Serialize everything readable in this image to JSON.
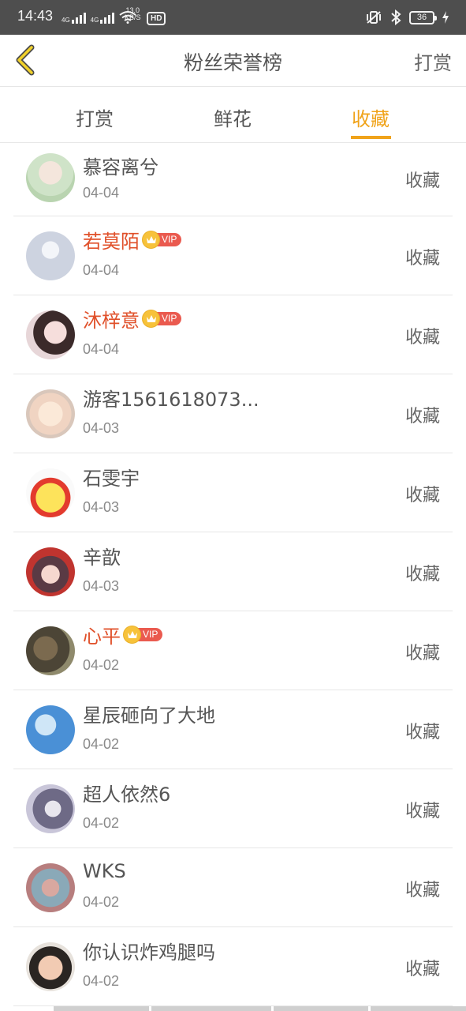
{
  "status_bar": {
    "time": "14:43",
    "net_type_1": "4G",
    "net_type_2": "4G",
    "speed_value": "13.0",
    "speed_unit": "KB/S",
    "hd_label": "HD",
    "battery": "36"
  },
  "header": {
    "title": "粉丝荣誉榜",
    "right_action": "打赏"
  },
  "tabs": [
    {
      "label": "打赏",
      "active": false
    },
    {
      "label": "鲜花",
      "active": false
    },
    {
      "label": "收藏",
      "active": true
    }
  ],
  "colors": {
    "accent": "#f0a31a",
    "vip_name": "#e0502a",
    "vip_badge": "#ea5a4f",
    "crown": "#f7c23a"
  },
  "fans": [
    {
      "name": "慕容离兮",
      "date": "04-04",
      "action": "收藏",
      "vip": false,
      "vip_label": ""
    },
    {
      "name": "若莫陌",
      "date": "04-04",
      "action": "收藏",
      "vip": true,
      "vip_label": "VIP"
    },
    {
      "name": "沐梓意",
      "date": "04-04",
      "action": "收藏",
      "vip": true,
      "vip_label": "VIP"
    },
    {
      "name": "游客1561618073...",
      "date": "04-03",
      "action": "收藏",
      "vip": false,
      "vip_label": ""
    },
    {
      "name": "石雯宇",
      "date": "04-03",
      "action": "收藏",
      "vip": false,
      "vip_label": ""
    },
    {
      "name": "辛歆",
      "date": "04-03",
      "action": "收藏",
      "vip": false,
      "vip_label": ""
    },
    {
      "name": "心平",
      "date": "04-02",
      "action": "收藏",
      "vip": true,
      "vip_label": "VIP"
    },
    {
      "name": "星辰砸向了大地",
      "date": "04-02",
      "action": "收藏",
      "vip": false,
      "vip_label": ""
    },
    {
      "name": "超人依然6",
      "date": "04-02",
      "action": "收藏",
      "vip": false,
      "vip_label": ""
    },
    {
      "name": "WKS",
      "date": "04-02",
      "action": "收藏",
      "vip": false,
      "vip_label": ""
    },
    {
      "name": "你认识炸鸡腿吗",
      "date": "04-02",
      "action": "收藏",
      "vip": false,
      "vip_label": ""
    }
  ]
}
